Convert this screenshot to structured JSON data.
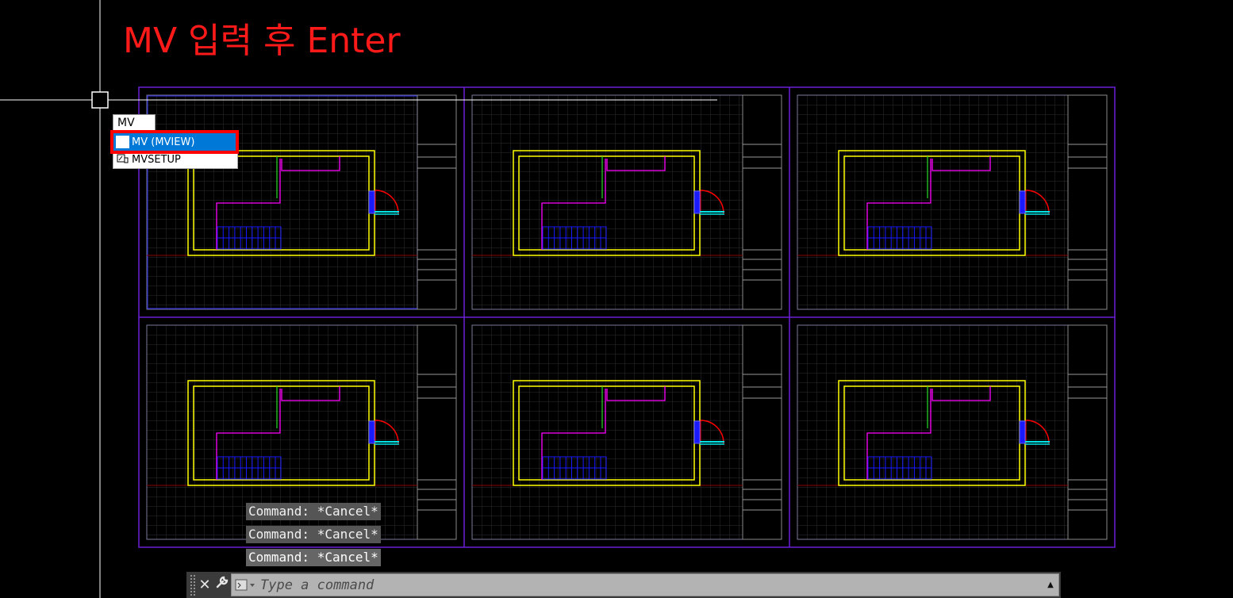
{
  "annotation": {
    "text": "MV 입력 후 Enter",
    "color": "#ff1a1a"
  },
  "autocomplete": {
    "typed": "MV",
    "items": [
      {
        "label": "MV (MVIEW)",
        "icon": "blank-icon",
        "selected": true
      },
      {
        "label": "MVSETUP",
        "icon": "mvsetup-icon",
        "selected": false
      }
    ],
    "highlight_color": "#ff0000"
  },
  "command_history": [
    "Command: *Cancel*",
    "Command: *Cancel*",
    "Command: *Cancel*"
  ],
  "command_line": {
    "placeholder": "Type a command",
    "close_icon": "close-icon",
    "customize_icon": "wrench-icon",
    "prompt_icon": "prompt-icon",
    "history_icon": "chevron-up-icon"
  },
  "layout_sheet": {
    "viewports": 6,
    "colors": {
      "frame": "#6a1fd6",
      "wall": "#ffff00",
      "interior": "#ff00ff",
      "stair": "#1a1aff",
      "door": "#ff0000",
      "window": "#00e5e5",
      "grid": "#333333",
      "axis": "#8b0000"
    }
  }
}
